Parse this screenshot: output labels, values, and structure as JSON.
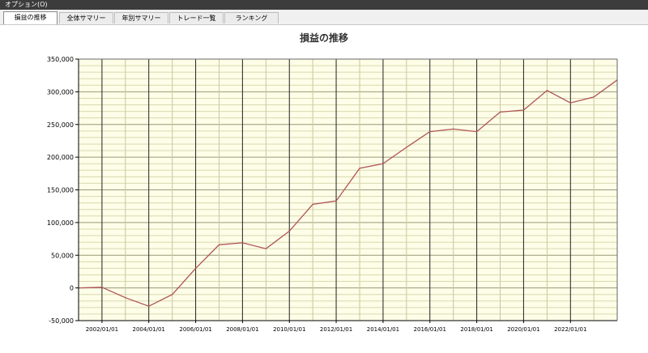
{
  "menubar": {
    "options_label": "オプション(O)"
  },
  "tabs": [
    {
      "label": "損益の推移",
      "active": true
    },
    {
      "label": "全体サマリー",
      "active": false
    },
    {
      "label": "年別サマリー",
      "active": false
    },
    {
      "label": "トレード一覧",
      "active": false
    },
    {
      "label": "ランキング",
      "active": false
    }
  ],
  "colors": {
    "plot_background": "#fdfde8",
    "line": "#b05454",
    "major_grid": "#222222",
    "minor_grid": "#d9d9b0"
  },
  "chart_data": {
    "type": "line",
    "title": "損益の推移",
    "xlabel": "",
    "ylabel": "",
    "ylim": [
      -50000,
      350000
    ],
    "xlim": [
      "2001/01/01",
      "2023/12/31"
    ],
    "grid": true,
    "legend": "none",
    "y_ticks": [
      -50000,
      0,
      50000,
      100000,
      150000,
      200000,
      250000,
      300000,
      350000
    ],
    "y_tick_labels": [
      "-50,000",
      "0",
      "50,000",
      "100,000",
      "150,000",
      "200,000",
      "250,000",
      "300,000",
      "350,000"
    ],
    "x_ticks": [
      "2002/01/01",
      "2004/01/01",
      "2006/01/01",
      "2008/01/01",
      "2010/01/01",
      "2012/01/01",
      "2014/01/01",
      "2016/01/01",
      "2018/01/01",
      "2020/01/01",
      "2022/01/01"
    ],
    "series": [
      {
        "x": [
          "2001/01/01",
          "2002/01/01",
          "2003/01/01",
          "2004/01/01",
          "2005/01/01",
          "2006/01/01",
          "2007/01/01",
          "2008/01/01",
          "2009/01/01",
          "2010/01/01",
          "2011/01/01",
          "2012/01/01",
          "2013/01/01",
          "2014/01/01",
          "2015/01/01",
          "2016/01/01",
          "2017/01/01",
          "2018/01/01",
          "2019/01/01",
          "2020/01/01",
          "2021/01/01",
          "2022/01/01",
          "2023/01/01",
          "2023/12/31"
        ],
        "values": [
          0,
          1000,
          -15000,
          -28000,
          -10000,
          30000,
          66000,
          69000,
          60000,
          87000,
          128000,
          133000,
          183000,
          190000,
          215000,
          239000,
          243000,
          239000,
          269000,
          272000,
          302000,
          283000,
          292000,
          318000
        ]
      }
    ]
  }
}
